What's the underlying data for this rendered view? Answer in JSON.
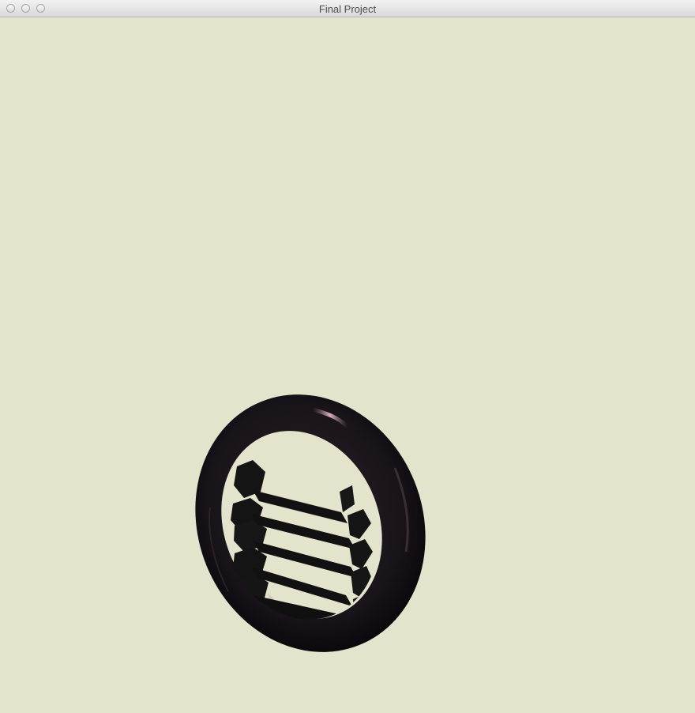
{
  "window": {
    "title": "Final Project",
    "controls": [
      "close",
      "minimize",
      "zoom"
    ]
  },
  "scene": {
    "background_color": "#e4e3cb",
    "objects": [
      {
        "name": "torus-ring",
        "color": "#1a1416"
      },
      {
        "name": "ladder",
        "rungs": 5,
        "color": "#111111"
      }
    ]
  }
}
